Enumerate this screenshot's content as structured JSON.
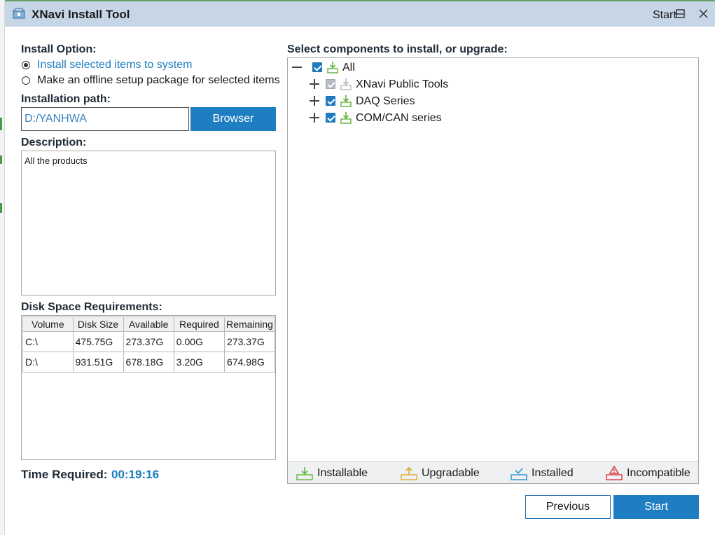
{
  "window": {
    "title": "XNavi Install Tool",
    "start_label": "Start",
    "controls": [
      "minimize",
      "maximize",
      "close"
    ]
  },
  "install_option": {
    "label": "Install Option:",
    "options": [
      {
        "label": "Install selected items to system",
        "selected": true
      },
      {
        "label": "Make an offline setup package for selected items",
        "selected": false
      }
    ]
  },
  "installation_path": {
    "label": "Installation path:",
    "value": "D:/YANHWA",
    "browse_label": "Browser"
  },
  "description": {
    "label": "Description:",
    "text": "All the products"
  },
  "disk_space": {
    "label": "Disk Space Requirements:",
    "columns": [
      "Volume",
      "Disk Size",
      "Available",
      "Required",
      "Remaining"
    ],
    "rows": [
      [
        "C:\\",
        "475.75G",
        "273.37G",
        "0.00G",
        "273.37G"
      ],
      [
        "D:\\",
        "931.51G",
        "678.18G",
        "3.20G",
        "674.98G"
      ]
    ]
  },
  "time_required": {
    "label": "Time Required:",
    "value": "00:19:16"
  },
  "components": {
    "label": "Select components to install, or upgrade:",
    "tree": [
      {
        "label": "All",
        "checked": true,
        "disabled": false,
        "expanded": true,
        "status": "installable"
      },
      {
        "label": "XNavi Public Tools",
        "checked": true,
        "disabled": true,
        "expanded": false,
        "status": "installable"
      },
      {
        "label": "DAQ Series",
        "checked": true,
        "disabled": false,
        "expanded": false,
        "status": "installable"
      },
      {
        "label": "COM/CAN series",
        "checked": true,
        "disabled": false,
        "expanded": false,
        "status": "installable"
      }
    ]
  },
  "legend": [
    {
      "label": "Installable",
      "icon": "installable-icon",
      "color": "#5db33a"
    },
    {
      "label": "Upgradable",
      "icon": "upgradable-icon",
      "color": "#e0a72a"
    },
    {
      "label": "Installed",
      "icon": "installed-icon",
      "color": "#2f8fd0"
    },
    {
      "label": "Incompatible",
      "icon": "incompatible-icon",
      "color": "#d9363e"
    }
  ],
  "footer": {
    "previous_label": "Previous",
    "start_label": "Start"
  },
  "colors": {
    "accent": "#1f7ec1",
    "titlebar": "#c6d6e6",
    "selected_text": "#1b7dbf"
  }
}
